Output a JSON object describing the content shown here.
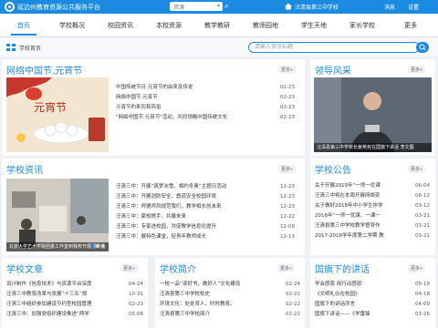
{
  "topbar": {
    "title": "延边州教育资源公共服务平台",
    "select_value": "资源",
    "school": "汪清县第三中学校",
    "links": [
      "消息",
      "设置"
    ]
  },
  "nav": {
    "items": [
      "首页",
      "学校概况",
      "校园资讯",
      "本校资源",
      "教学教研",
      "教师园地",
      "学生天地",
      "家长学校",
      "更多"
    ],
    "active": 0
  },
  "crumb": {
    "label": "学校首页"
  },
  "search": {
    "placeholder": "请输入资讯标题"
  },
  "more_label": "更多»",
  "festival": {
    "title": "网络中国节.元宵节",
    "image_text": "元宵节",
    "items": [
      {
        "title": "中国传统节日:元宵节的由来及传说",
        "date": "02-23"
      },
      {
        "title": "网络中国节.元宵节",
        "date": "02-23"
      },
      {
        "title": "元宵节的来历和风俗",
        "date": "02-23"
      },
      {
        "title": "\"网络中国节.元宵节\"活动，共同领略中国传统文化",
        "date": "02-23"
      }
    ]
  },
  "leader": {
    "title": "领导风采",
    "caption": "汪清县第三中学校长姜英宪在国旗下讲话",
    "caption_tail": "李文图"
  },
  "news": {
    "title": "学校资讯",
    "caption": "北京大学艺术学院团委工作室到我校开展调研活",
    "items": [
      {
        "title": "汪清三中：开展“筑梦冰雪，相约冬奥”主题日活动",
        "date": "12-23"
      },
      {
        "title": "汪清三中：开展消防安全、震道安全校园环境",
        "date": "12-23"
      },
      {
        "title": "汪清三中：师德师风规范我们，教学相长创未来",
        "date": "12-23"
      },
      {
        "title": "汪清三中：家校携手，共展未来",
        "date": "12-22"
      },
      {
        "title": "汪清三中：专家进校园，共促教学信息化提升",
        "date": "12-09"
      },
      {
        "title": "汪清三中：展特色课堂，促青年教师成长",
        "date": "12-13"
      }
    ]
  },
  "notice": {
    "title": "学校公告",
    "items": [
      {
        "title": "关于开展2019年“一师一优课",
        "date": "06-04"
      },
      {
        "title": "汪清三中将在本周开展网络安",
        "date": "06-12"
      },
      {
        "title": "关于做好2018年中小学生休学",
        "date": "03-12"
      },
      {
        "title": "2018年“一师一优课、一课一",
        "date": "03-21"
      },
      {
        "title": "汪清县第三中学校教学督导作",
        "date": "03-21"
      },
      {
        "title": "2017-2018学年度第二学期 教",
        "date": "03-21"
      }
    ]
  },
  "articles": {
    "title": "学校文章",
    "items": [
      {
        "title": "设计制作《信息技术》与资源平台深度",
        "date": "04-24"
      },
      {
        "title": "汪清三中教育改革与发展“十三五”规",
        "date": "10-31"
      },
      {
        "title": "汪清三中组织参加建设节约型校园管理",
        "date": "02-23"
      },
      {
        "title": "汪清三中：加强党组织建设推进“两学",
        "date": "05-08"
      }
    ]
  },
  "intro": {
    "title": "学校简介",
    "items": [
      {
        "title": "一校一品“读好书，做好人”文化建设",
        "date": "02-24"
      },
      {
        "title": "汪清县第三中学校校史",
        "date": "02-22"
      },
      {
        "title": "环境文化：处处育人，时时教育。",
        "date": "02-22"
      },
      {
        "title": "汪清县第三中学校简介",
        "date": "02-22"
      }
    ]
  },
  "speech": {
    "title": "国旗下的讲话",
    "items": [
      {
        "title": "学会感恩 用行动感恩",
        "date": "05-19"
      },
      {
        "title": "《文明礼仪在校园》",
        "date": "04-18"
      },
      {
        "title": "国旗下的讲话序言",
        "date": "04-09"
      },
      {
        "title": "国旗下讲话——《学雷锋",
        "date": "03-26"
      }
    ]
  }
}
